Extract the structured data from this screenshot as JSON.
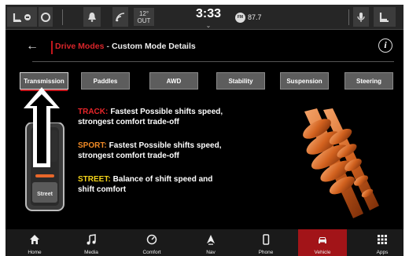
{
  "status_bar": {
    "time": "3:33",
    "outside_label": "12°\nOUT",
    "radio_label": "FM",
    "radio_station": "87.7"
  },
  "header": {
    "back_icon": "back-arrow-icon",
    "breadcrumb_parent": "Drive Modes",
    "breadcrumb_separator": "-",
    "breadcrumb_current": "Custom Mode Details",
    "info_label": "i"
  },
  "tabs": [
    {
      "label": "Transmission",
      "active": true
    },
    {
      "label": "Paddles",
      "active": false
    },
    {
      "label": "AWD",
      "active": false
    },
    {
      "label": "Stability",
      "active": false
    },
    {
      "label": "Suspension",
      "active": false
    },
    {
      "label": "Steering",
      "active": false
    }
  ],
  "shifter": {
    "selected_label": "Street"
  },
  "modes": [
    {
      "name": "TRACK:",
      "color": "#e8252a",
      "description": "Fastest Possible shifts speed, strongest comfort trade-off"
    },
    {
      "name": "SPORT:",
      "color": "#f08a26",
      "description": "Fastest Possible shifts speed, strongest comfort trade-off"
    },
    {
      "name": "STREET:",
      "color": "#f2d21a",
      "description": "Balance of shift speed and shift comfort"
    }
  ],
  "bottom_nav": [
    {
      "label": "Home",
      "icon": "home-icon",
      "active": false
    },
    {
      "label": "Media",
      "icon": "music-note-icon",
      "active": false
    },
    {
      "label": "Comfort",
      "icon": "comfort-icon",
      "active": false
    },
    {
      "label": "Nav",
      "icon": "navigation-arrow-icon",
      "active": false
    },
    {
      "label": "Phone",
      "icon": "phone-icon",
      "active": false
    },
    {
      "label": "Vehicle",
      "icon": "car-icon",
      "active": true
    },
    {
      "label": "Apps",
      "icon": "apps-grid-icon",
      "active": false
    }
  ],
  "colors": {
    "accent": "#c4161c",
    "background": "#000000",
    "tab_background": "#5d5d5d"
  }
}
